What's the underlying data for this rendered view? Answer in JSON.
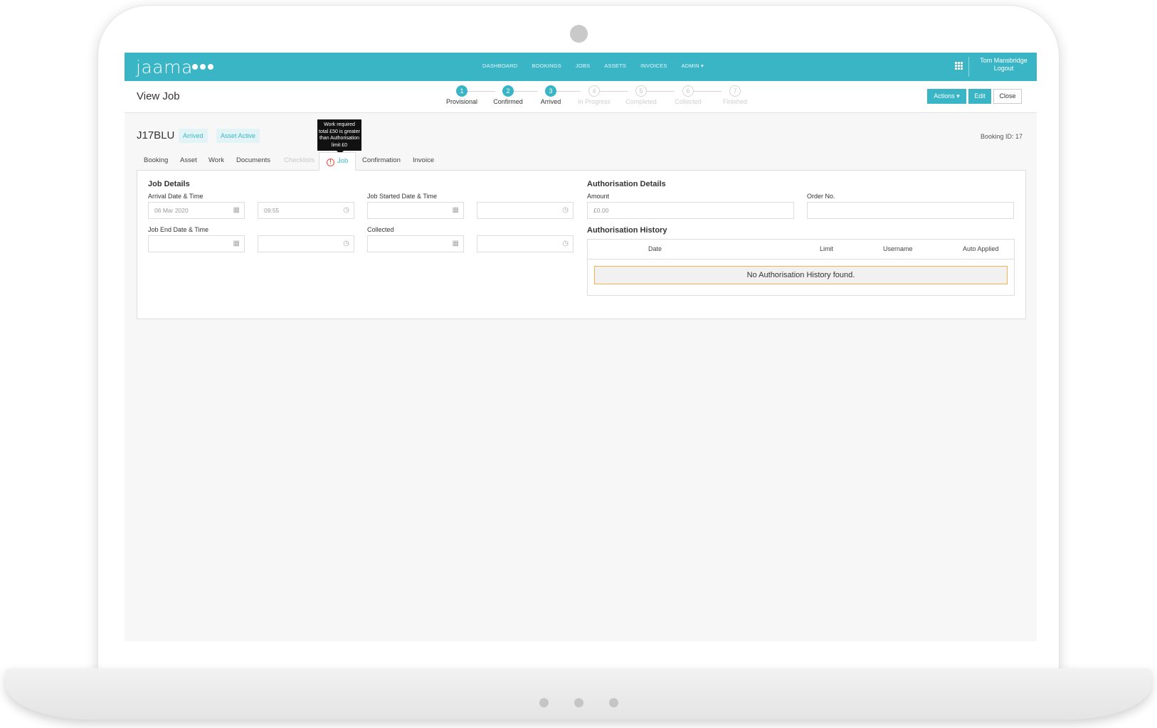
{
  "app": {
    "logo": "jaama"
  },
  "nav": [
    "DASHBOARD",
    "BOOKINGS",
    "JOBS",
    "ASSETS",
    "INVOICES",
    "ADMIN ▾"
  ],
  "user": {
    "name": "Tom Mansbridge",
    "logout": "Logout"
  },
  "page": {
    "title": "View Job"
  },
  "steps": [
    {
      "num": "1",
      "label": "Provisional",
      "state": "active"
    },
    {
      "num": "2",
      "label": "Confirmed",
      "state": "active"
    },
    {
      "num": "3",
      "label": "Arrived",
      "state": "active"
    },
    {
      "num": "4",
      "label": "In Progress",
      "state": "inactive"
    },
    {
      "num": "5",
      "label": "Completed",
      "state": "inactive"
    },
    {
      "num": "6",
      "label": "Collected",
      "state": "inactive"
    },
    {
      "num": "7",
      "label": "Finished",
      "state": "inactive"
    }
  ],
  "actions": {
    "actions": "Actions ▾",
    "edit": "Edit",
    "close": "Close"
  },
  "job": {
    "id": "J17BLU",
    "badges": [
      "Arrived",
      "Asset Active"
    ],
    "booking_id": "Booking ID: 17",
    "tooltip": "Work required total £50 is greater than Authorisation limit £0"
  },
  "tabs": [
    "Booking",
    "Asset",
    "Work",
    "Documents",
    "Checklists",
    "Job",
    "Confirmation",
    "Invoice"
  ],
  "job_details": {
    "title": "Job Details",
    "arrival_label": "Arrival Date & Time",
    "arrival_date": "06 Mar 2020",
    "arrival_time": "09:55",
    "started_label": "Job Started Date & Time",
    "end_label": "Job End Date & Time",
    "collected_label": "Collected"
  },
  "authorisation": {
    "title": "Authorisation Details",
    "amount_label": "Amount",
    "amount_value": "£0.00",
    "order_label": "Order No.",
    "history_title": "Authorisation History",
    "columns": [
      "Date",
      "Limit",
      "Username",
      "Auto Applied"
    ],
    "empty": "No Authorisation History found."
  },
  "colors": {
    "brand": "#3ab5c6",
    "warning": "#e84c3d"
  }
}
